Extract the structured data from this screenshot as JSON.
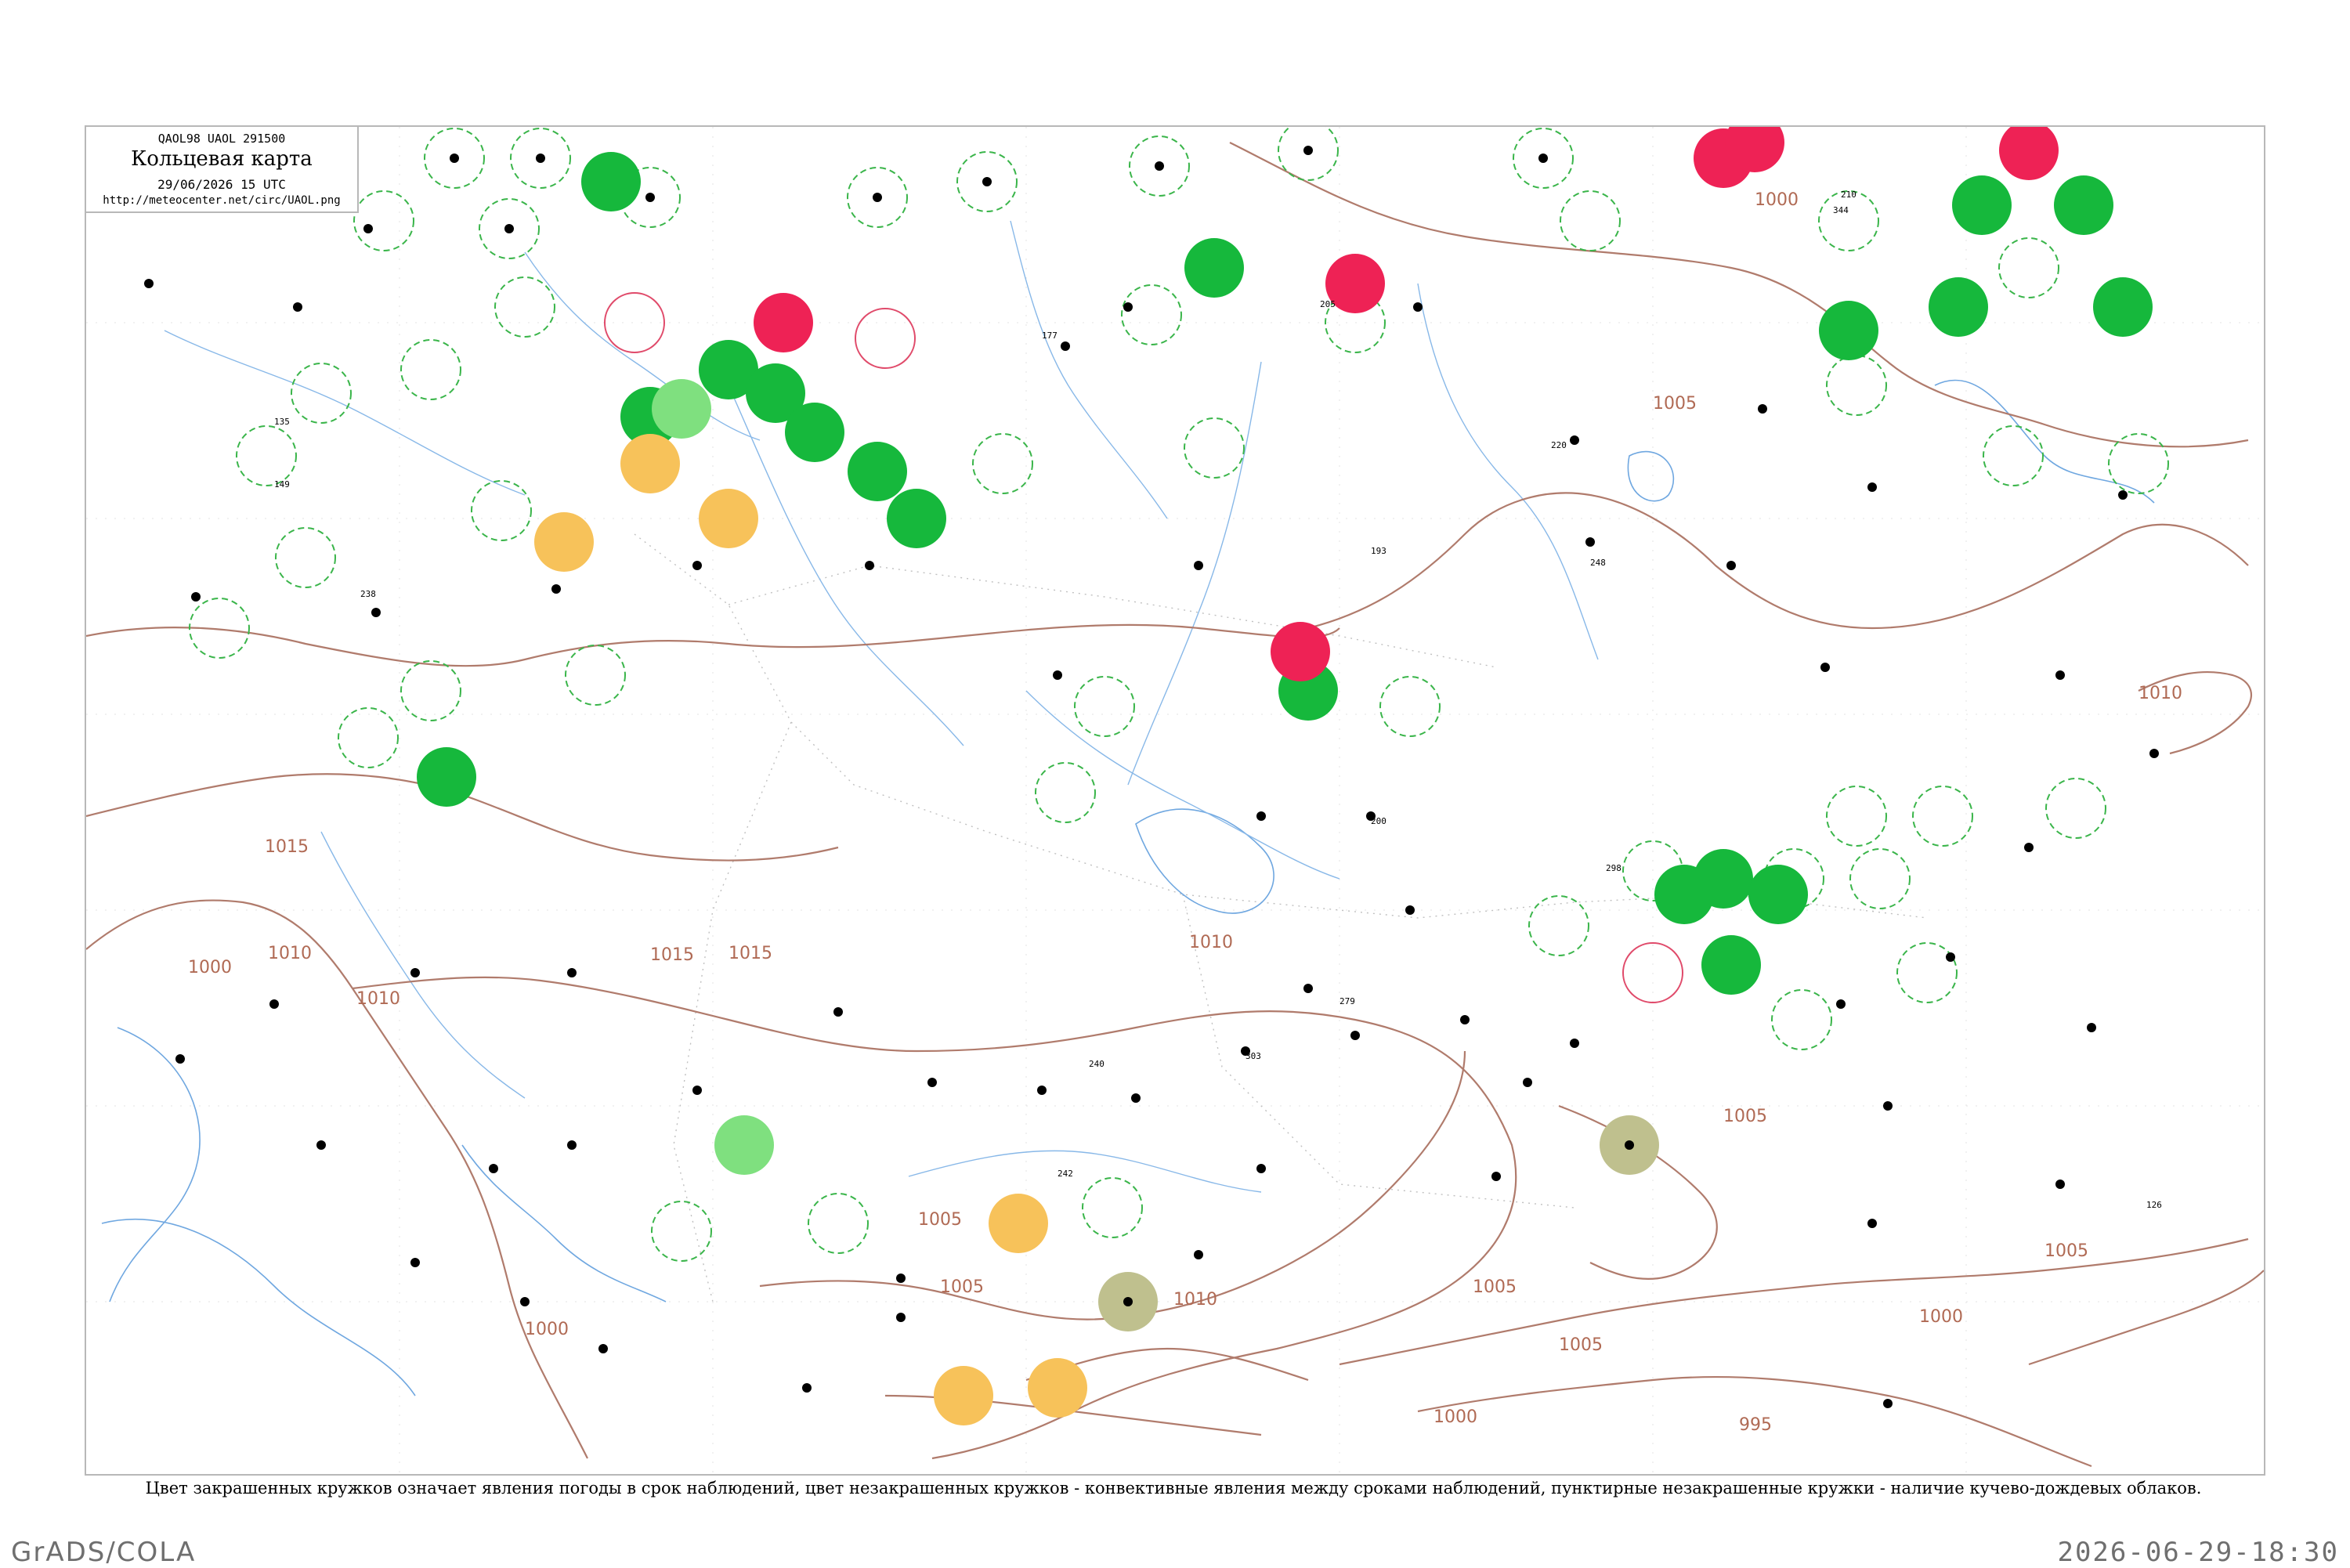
{
  "header": {
    "code_line": "QAOL98  UAOL  291500",
    "title": "Кольцевая карта",
    "datetime": "29/06/2026 15 UTC",
    "url": "http://meteocenter.net/circ/UAOL.png"
  },
  "caption": "Цвет закрашенных кружков означает явления погоды в срок наблюдений, цвет незакрашенных кружков - конвективные явления между сроками наблюдений, пунктирные незакрашенные кружки - наличие кучево-дождевых облаков.",
  "footer": {
    "left": "GrADS/COLA",
    "right": "2026-06-29-18:30"
  },
  "colors": {
    "rain_green": "#16b83c",
    "light_green": "#7fe07f",
    "thunder_red": "#ee2255",
    "haze_orange": "#f7c25a",
    "dust_olive": "#bfc08e",
    "convective_ring_green": "#3ab54a",
    "convective_ring_red": "#e04a6a",
    "isobar": "#b07b6c",
    "water": "#6fa7e0"
  },
  "isobar_labels": [
    "1000",
    "1005",
    "1010",
    "1015",
    "1000",
    "1005",
    "1010",
    "1015",
    "1010",
    "1005",
    "1010",
    "1005",
    "1000",
    "995",
    "1005",
    "1000",
    "1005",
    "1010",
    "1015",
    "1005",
    "1000"
  ],
  "station_values": [
    "193",
    "238",
    "248",
    "279",
    "240",
    "205",
    "177",
    "303",
    "242",
    "298",
    "344",
    "210",
    "200",
    "126",
    "135",
    "149",
    "220"
  ]
}
